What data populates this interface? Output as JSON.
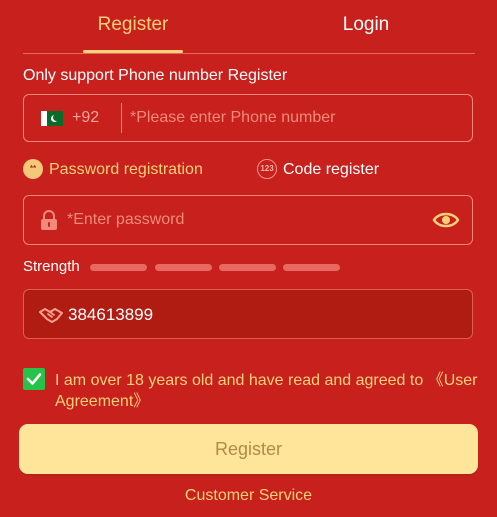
{
  "tabs": {
    "register_label": "Register",
    "login_label": "Login"
  },
  "form": {
    "support_text": "Only support Phone number Register",
    "phone": {
      "country_code": "+92",
      "placeholder": "*Please enter Phone number",
      "flag_icon": "pakistan-flag-icon"
    },
    "modes": {
      "password_label": "Password registration",
      "code_label": "Code register",
      "code_icon_text": "123"
    },
    "password": {
      "placeholder": "*Enter password",
      "lock_icon": "lock-icon",
      "eye_icon": "eye-icon"
    },
    "strength": {
      "label": "Strength"
    },
    "invite": {
      "value": "384613899",
      "icon": "handshake-icon"
    },
    "agreement": {
      "checked": true,
      "text": "I am over 18 years old and have read and agreed to ",
      "link_text": "《User Agreement》"
    },
    "register_button_label": "Register",
    "customer_service_label": "Customer Service"
  },
  "colors": {
    "background": "#c8201c",
    "accent": "#f8d27a",
    "button": "#ffe59a",
    "checkbox": "#27c24a"
  }
}
